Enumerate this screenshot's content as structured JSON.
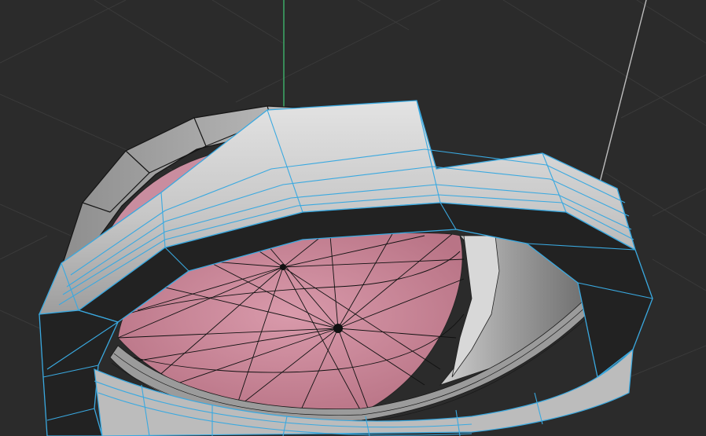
{
  "viewport": {
    "background_color": "#2b2b2b",
    "grid_color": "#3a3a3a",
    "y_axis_color": "#3fb46b",
    "z_axis_color": "#bdbdbd",
    "selection_wire_color": "#3aa9e0",
    "mesh_wire_color": "#151515",
    "mesh_shell_color": "#c9c9c9",
    "mesh_inner_color": "#c98d9f",
    "mesh_side_color": "#222222"
  }
}
